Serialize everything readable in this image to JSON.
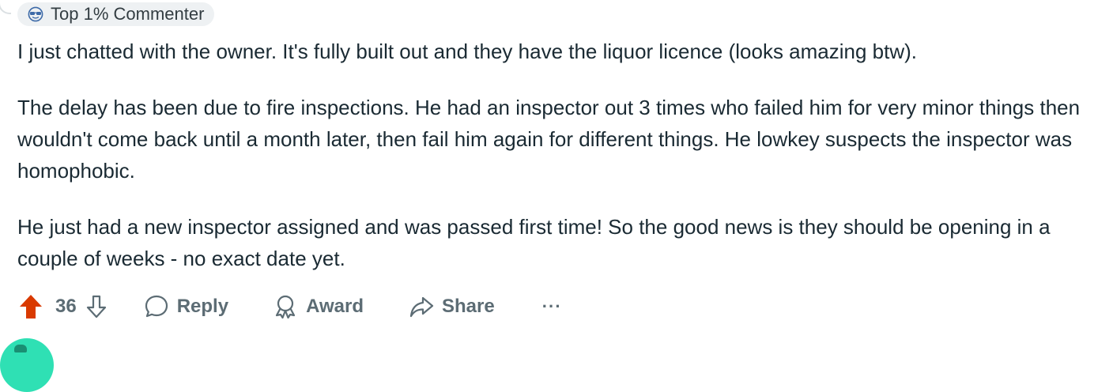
{
  "badge": {
    "icon": "sunglasses-icon",
    "label": "Top 1% Commenter"
  },
  "comment": {
    "paragraphs": [
      "I just chatted with the owner. It's fully built out and they have the liquor licence (looks amazing btw).",
      "The delay has been due to fire inspections. He had an inspector out 3 times who failed him for very minor things then wouldn't come back until a month later, then fail him again for different things. He lowkey suspects the inspector was homophobic.",
      "He just had a new inspector assigned and was passed first time! So the good news is they should be opening in a couple of weeks - no exact date yet."
    ]
  },
  "actions": {
    "vote_count": "36",
    "upvote_icon": "upvote-arrow-icon",
    "downvote_icon": "downvote-arrow-icon",
    "reply_label": "Reply",
    "award_label": "Award",
    "share_label": "Share",
    "more_label": "···",
    "upvote_active": true
  },
  "colors": {
    "upvote_active": "#d93a00",
    "badge_bg": "#eef1f3",
    "action_text": "#5c6c74",
    "body_text": "#1a2a33",
    "next_avatar": "#2fe0b4"
  }
}
